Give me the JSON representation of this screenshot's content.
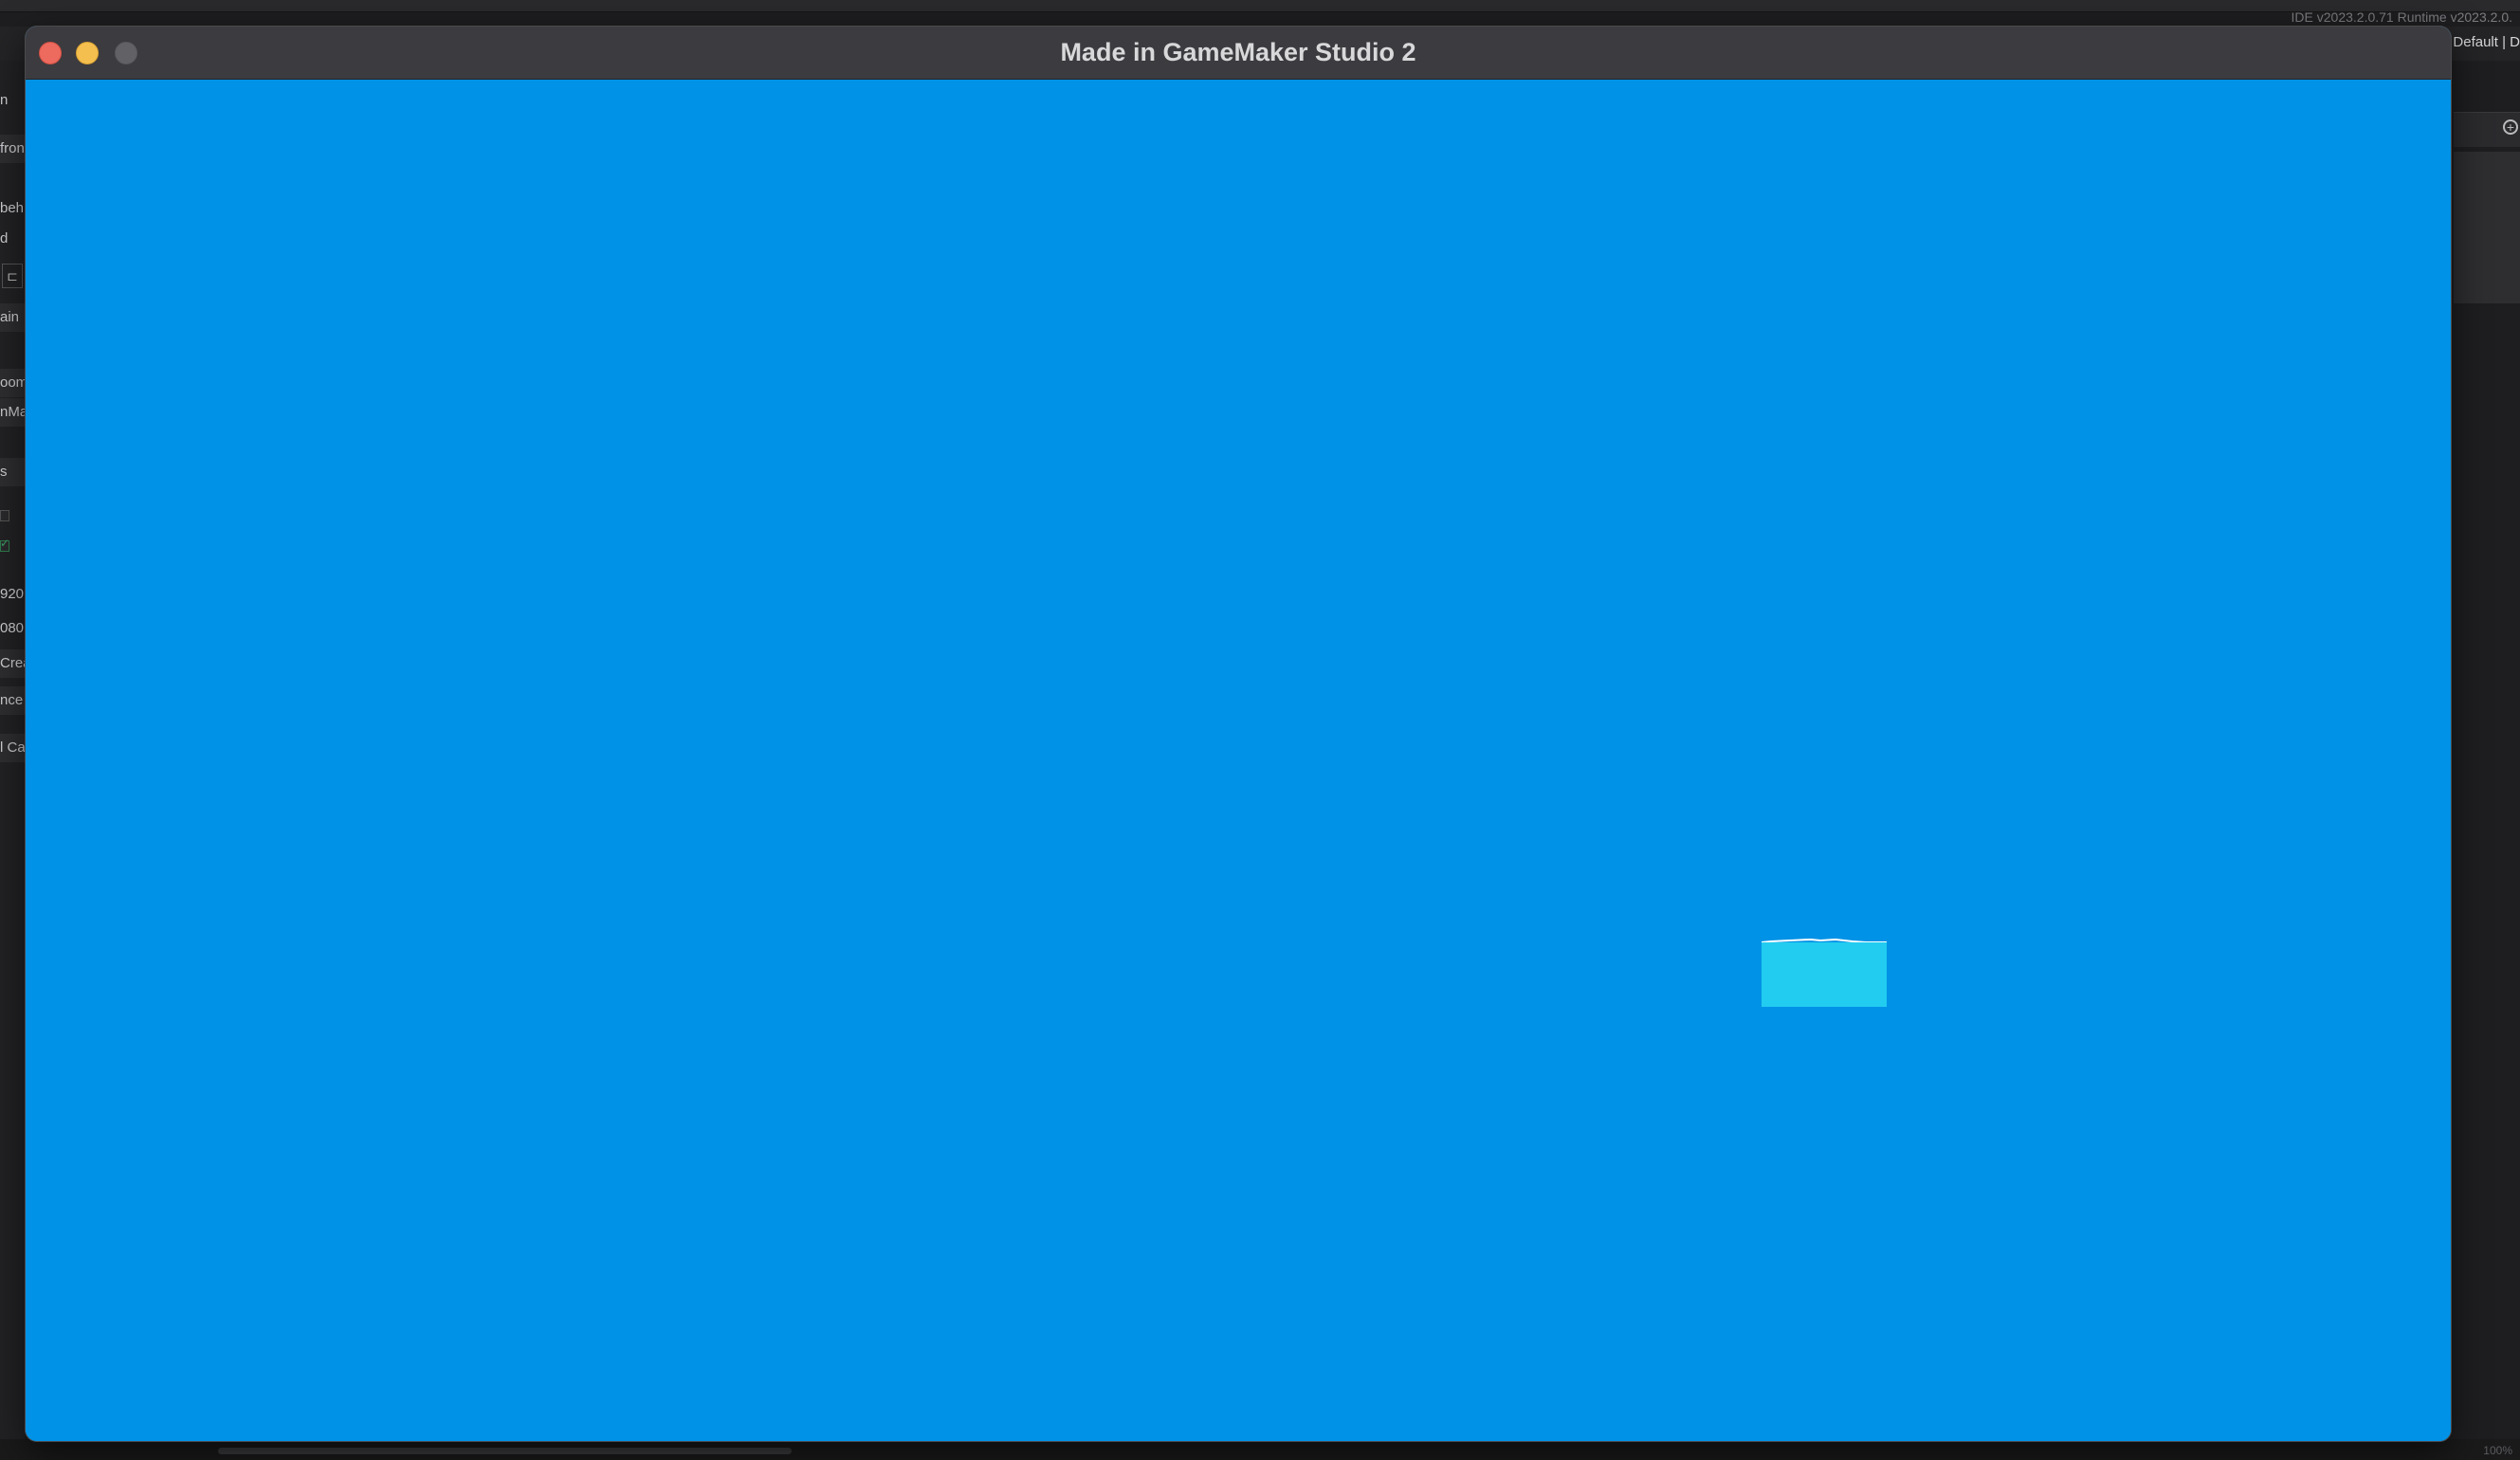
{
  "ide": {
    "version_text": "IDE v2023.2.0.71  Runtime v2023.2.0.",
    "config_text": "Default | D",
    "left_panel": {
      "rows": [
        "n",
        "fron",
        "beh",
        "d",
        "ain",
        "oom",
        "nMa",
        "s",
        "920",
        "080",
        "Crea",
        "nce",
        "l Ca"
      ]
    },
    "zoom_readout": "100%"
  },
  "game_window": {
    "title": "Made in GameMaker Studio 2",
    "canvas_color": "#0092e6",
    "object_color": "#22ccf0"
  }
}
